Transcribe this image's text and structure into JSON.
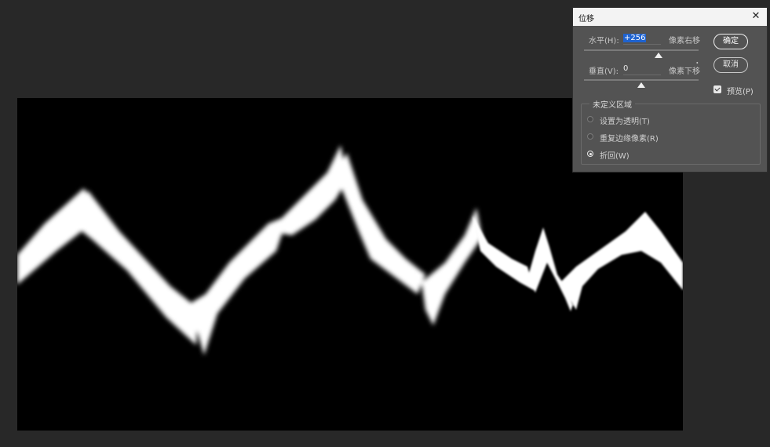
{
  "dialog": {
    "title": "位移",
    "horizontal": {
      "label": "水平(H):",
      "value": "+256",
      "unit": "像素右移",
      "slider_fraction": 0.65
    },
    "vertical": {
      "label": "垂直(V):",
      "value": "0",
      "unit": "像素下移",
      "slider_fraction": 0.5
    },
    "ok_label": "确定",
    "cancel_label": "取消",
    "preview": {
      "label": "预览(P)",
      "checked": true
    },
    "undefined_area": {
      "title": "未定义区域",
      "options": [
        {
          "label": "设置为透明(T)",
          "selected": false
        },
        {
          "label": "重复边缘像素(R)",
          "selected": false
        },
        {
          "label": "折回(W)",
          "selected": true
        }
      ]
    }
  },
  "colors": {
    "workspace": "#282828",
    "canvas": "#000000",
    "dialog_bg": "#535353",
    "selection": "#1f63d0"
  }
}
